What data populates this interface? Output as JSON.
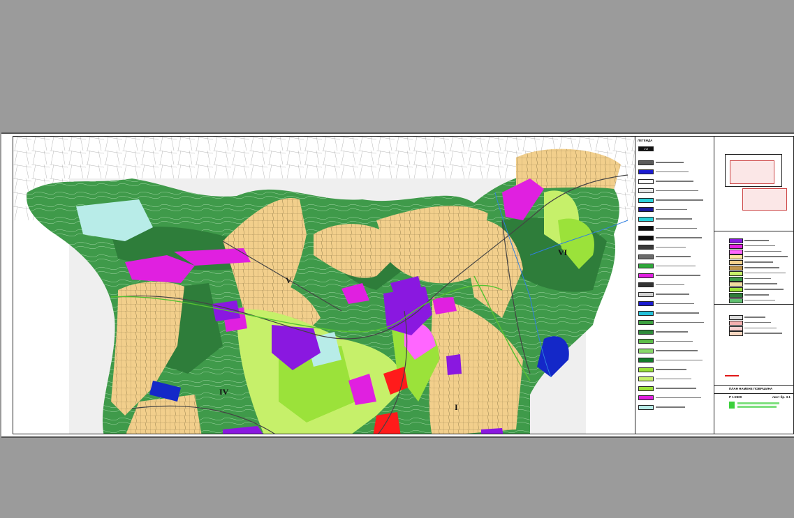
{
  "map": {
    "zone_labels": [
      "IV",
      "V",
      "VI",
      "I"
    ],
    "colors": {
      "forest": "#3f9a4a",
      "forest_dark": "#2e7d3a",
      "meadow": "#c6f06a",
      "lime": "#9be23a",
      "tan": "#f2cf8c",
      "magenta": "#e020e0",
      "violet": "#8a18e0",
      "light_cyan": "#b8ece8",
      "red": "#ff1b1b",
      "blue": "#1428c8",
      "road": "#444444"
    }
  },
  "legend": {
    "heading": "ЛЕГЕНДА",
    "zone_marker": "I-VI",
    "items": [
      {
        "color": "#5a5a5a"
      },
      {
        "color": "#1b1bd0"
      },
      {
        "color": "#ffffff"
      },
      {
        "color": "#e8e8e8"
      },
      {
        "color": "#2bd0d8"
      },
      {
        "color": "#1b1b9a"
      },
      {
        "color": "#2bd0d8"
      },
      {
        "color": "#0e0e0e"
      },
      {
        "color": "#0e0e0e"
      },
      {
        "color": "#3a3a3a"
      },
      {
        "color": "#6b6b6b"
      },
      {
        "color": "#2ea83a"
      },
      {
        "color": "#e020e0"
      },
      {
        "color": "#333333"
      },
      {
        "color": "#d0d0d0"
      },
      {
        "color": "#1b1bd0"
      },
      {
        "color": "#23c0d8"
      },
      {
        "color": "#3ca040"
      },
      {
        "color": "#2e8b3a"
      },
      {
        "color": "#5cbd49"
      },
      {
        "color": "#88d86a"
      },
      {
        "color": "#127a2a"
      },
      {
        "color": "#9be23a"
      },
      {
        "color": "#c6f06a"
      },
      {
        "color": "#9be23a"
      },
      {
        "color": "#e020e0"
      },
      {
        "color": "#b8ece8"
      }
    ]
  },
  "title_block": {
    "title": "ПЛАН НАМЕНЕ ПОВРШИНА",
    "scale": "Р 1:2500",
    "sheet_no": "лист бр. 3.1",
    "land_use_colors": [
      "#8a18e0",
      "#e020e0",
      "#ff66ff",
      "#ffe6a0",
      "#f2cf8c",
      "#c2964c",
      "#c6f06a",
      "#3c9a48",
      "#f0dba0",
      "#9be23a",
      "#2e7d3a",
      "#60c070"
    ],
    "legend2_colors": [
      "#dcdcdc",
      "#f5b0b0",
      "#f9d0d0",
      "#f7d6c0"
    ],
    "red_line_color": "#e01818",
    "logo_color": "#3cd03c"
  }
}
